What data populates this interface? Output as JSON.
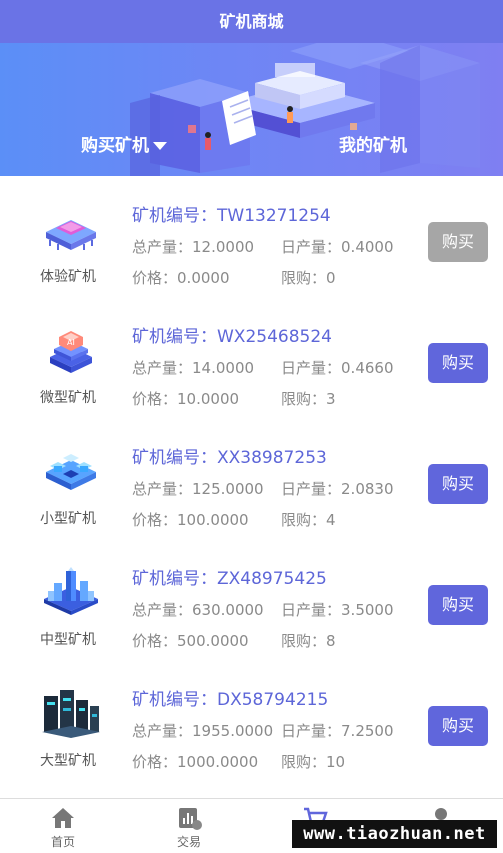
{
  "header": {
    "title": "矿机商城"
  },
  "tabs": {
    "buy_label": "购买矿机",
    "mine_label": "我的矿机"
  },
  "labels": {
    "code_prefix": "矿机编号：",
    "total_prefix": "总产量：",
    "daily_prefix": "日产量：",
    "price_prefix": "价格：",
    "limit_prefix": "限购："
  },
  "machines": [
    {
      "type": "体验矿机",
      "code": "TW13271254",
      "total": "12.0000",
      "daily": "0.4000",
      "price": "0.0000",
      "limit": "0",
      "button": "购买",
      "disabled": true,
      "icon": "chip-icon"
    },
    {
      "type": "微型矿机",
      "code": "WX25468524",
      "total": "14.0000",
      "daily": "0.4660",
      "price": "10.0000",
      "limit": "3",
      "button": "购买",
      "disabled": false,
      "icon": "stacked-chip-icon"
    },
    {
      "type": "小型矿机",
      "code": "XX38987253",
      "total": "125.0000",
      "daily": "2.0830",
      "price": "100.0000",
      "limit": "4",
      "button": "购买",
      "disabled": false,
      "icon": "cube-cluster-icon"
    },
    {
      "type": "中型矿机",
      "code": "ZX48975425",
      "total": "630.0000",
      "daily": "3.5000",
      "price": "500.0000",
      "limit": "8",
      "button": "购买",
      "disabled": false,
      "icon": "city-server-icon"
    },
    {
      "type": "大型矿机",
      "code": "DX58794215",
      "total": "1955.0000",
      "daily": "7.2500",
      "price": "1000.0000",
      "limit": "10",
      "button": "购买",
      "disabled": false,
      "icon": "rack-server-icon"
    }
  ],
  "nav": [
    {
      "label": "首页",
      "icon": "home-icon"
    },
    {
      "label": "交易",
      "icon": "chart-icon"
    },
    {
      "label": "",
      "icon": "cart-icon"
    },
    {
      "label": "",
      "icon": "user-icon"
    }
  ],
  "watermark": "www.tiaozhuan.net",
  "colors": {
    "header": "#6a73e6",
    "accent": "#6066dc",
    "disabled": "#a6a6a6",
    "code": "#5d66d8"
  }
}
